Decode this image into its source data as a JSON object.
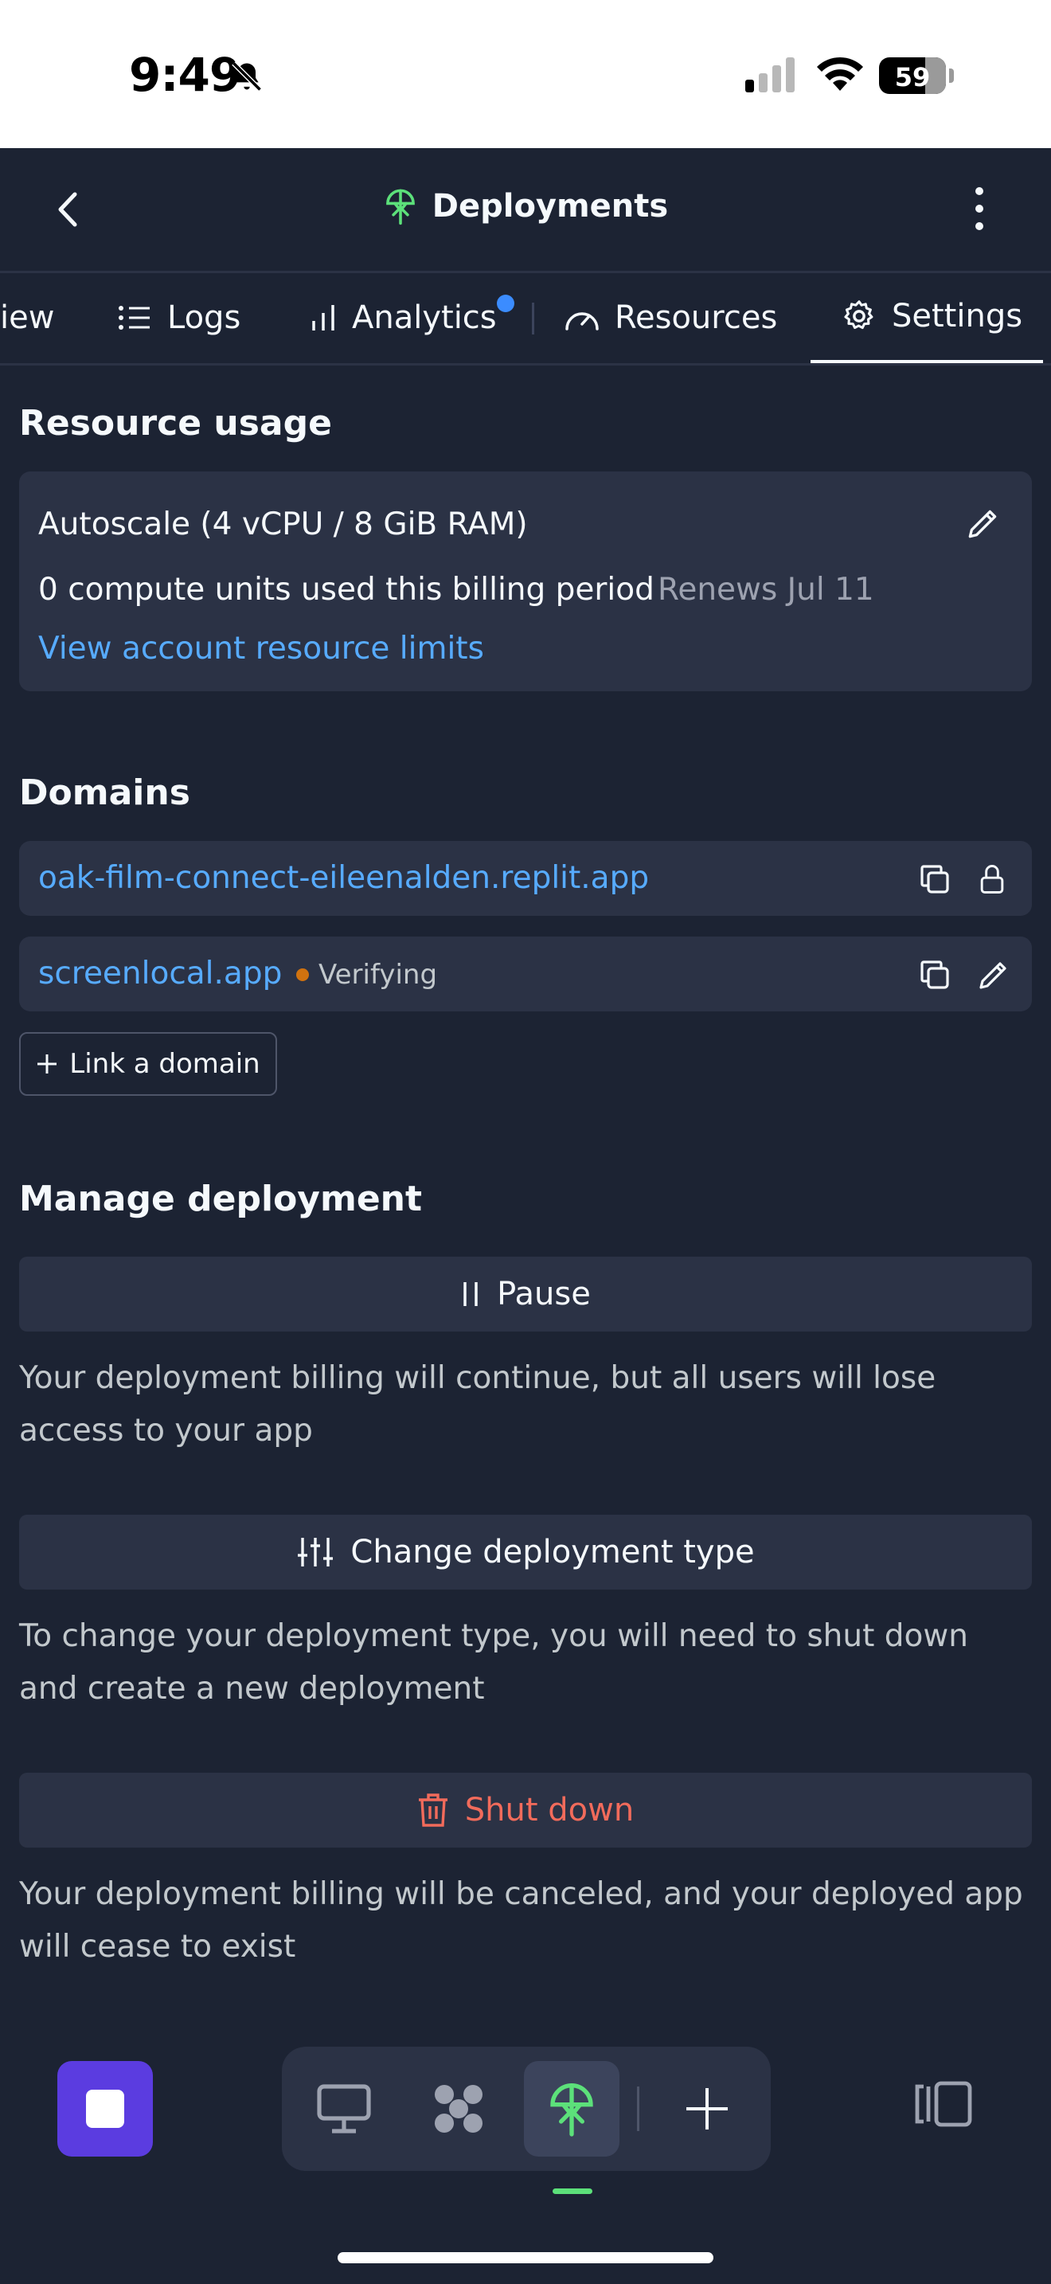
{
  "status_bar": {
    "time": "9:49",
    "battery": "59",
    "icons": [
      "bell-slash-icon",
      "signal-icon",
      "wifi-icon",
      "battery-icon"
    ]
  },
  "header": {
    "title": "Deployments",
    "icons": [
      "back-chevron-icon",
      "deployments-icon",
      "kebab-menu-icon"
    ]
  },
  "tabs": [
    {
      "label": "iew",
      "icon": null
    },
    {
      "label": "Logs",
      "icon": "list-icon"
    },
    {
      "label": "Analytics",
      "icon": "bar-chart-icon",
      "notification": true
    },
    {
      "label": "Resources",
      "icon": "gauge-icon"
    },
    {
      "label": "Settings",
      "icon": "gear-icon",
      "active": true
    }
  ],
  "resource_usage": {
    "heading": "Resource usage",
    "machine": "Autoscale (4 vCPU / 8 GiB RAM)",
    "usage": "0 compute units used this billing period",
    "renews": "Renews Jul 11",
    "limits_link": "View account resource limits"
  },
  "domains": {
    "heading": "Domains",
    "items": [
      {
        "name": "oak-film-connect-eileenalden.replit.app",
        "status": "",
        "actions": [
          "copy-icon",
          "lock-icon"
        ]
      },
      {
        "name": "screenlocal.app",
        "status": "Verifying",
        "actions": [
          "copy-icon",
          "pencil-icon"
        ]
      }
    ],
    "link_button": "Link a domain"
  },
  "manage": {
    "heading": "Manage deployment",
    "pause": {
      "label": "Pause",
      "desc": "Your deployment billing will continue, but all users will lose access to your app"
    },
    "change_type": {
      "label": "Change deployment type",
      "desc": "To change your deployment type, you will need to shut down and create a new deployment"
    },
    "shutdown": {
      "label": "Shut down",
      "desc": "Your deployment billing will be canceled, and your deployed app will cease to exist"
    }
  },
  "bottom_bar": {
    "items": [
      "stop-button",
      "webview-icon",
      "workspace-icon",
      "deployments-icon",
      "add-icon",
      "panels-icon"
    ]
  },
  "colors": {
    "background": "#1c2333",
    "surface": "#2b3245",
    "link": "#57abff",
    "danger": "#f26b5b",
    "accent": "#5b3ce0",
    "success": "#5ce07a",
    "warning": "#d0720f"
  }
}
